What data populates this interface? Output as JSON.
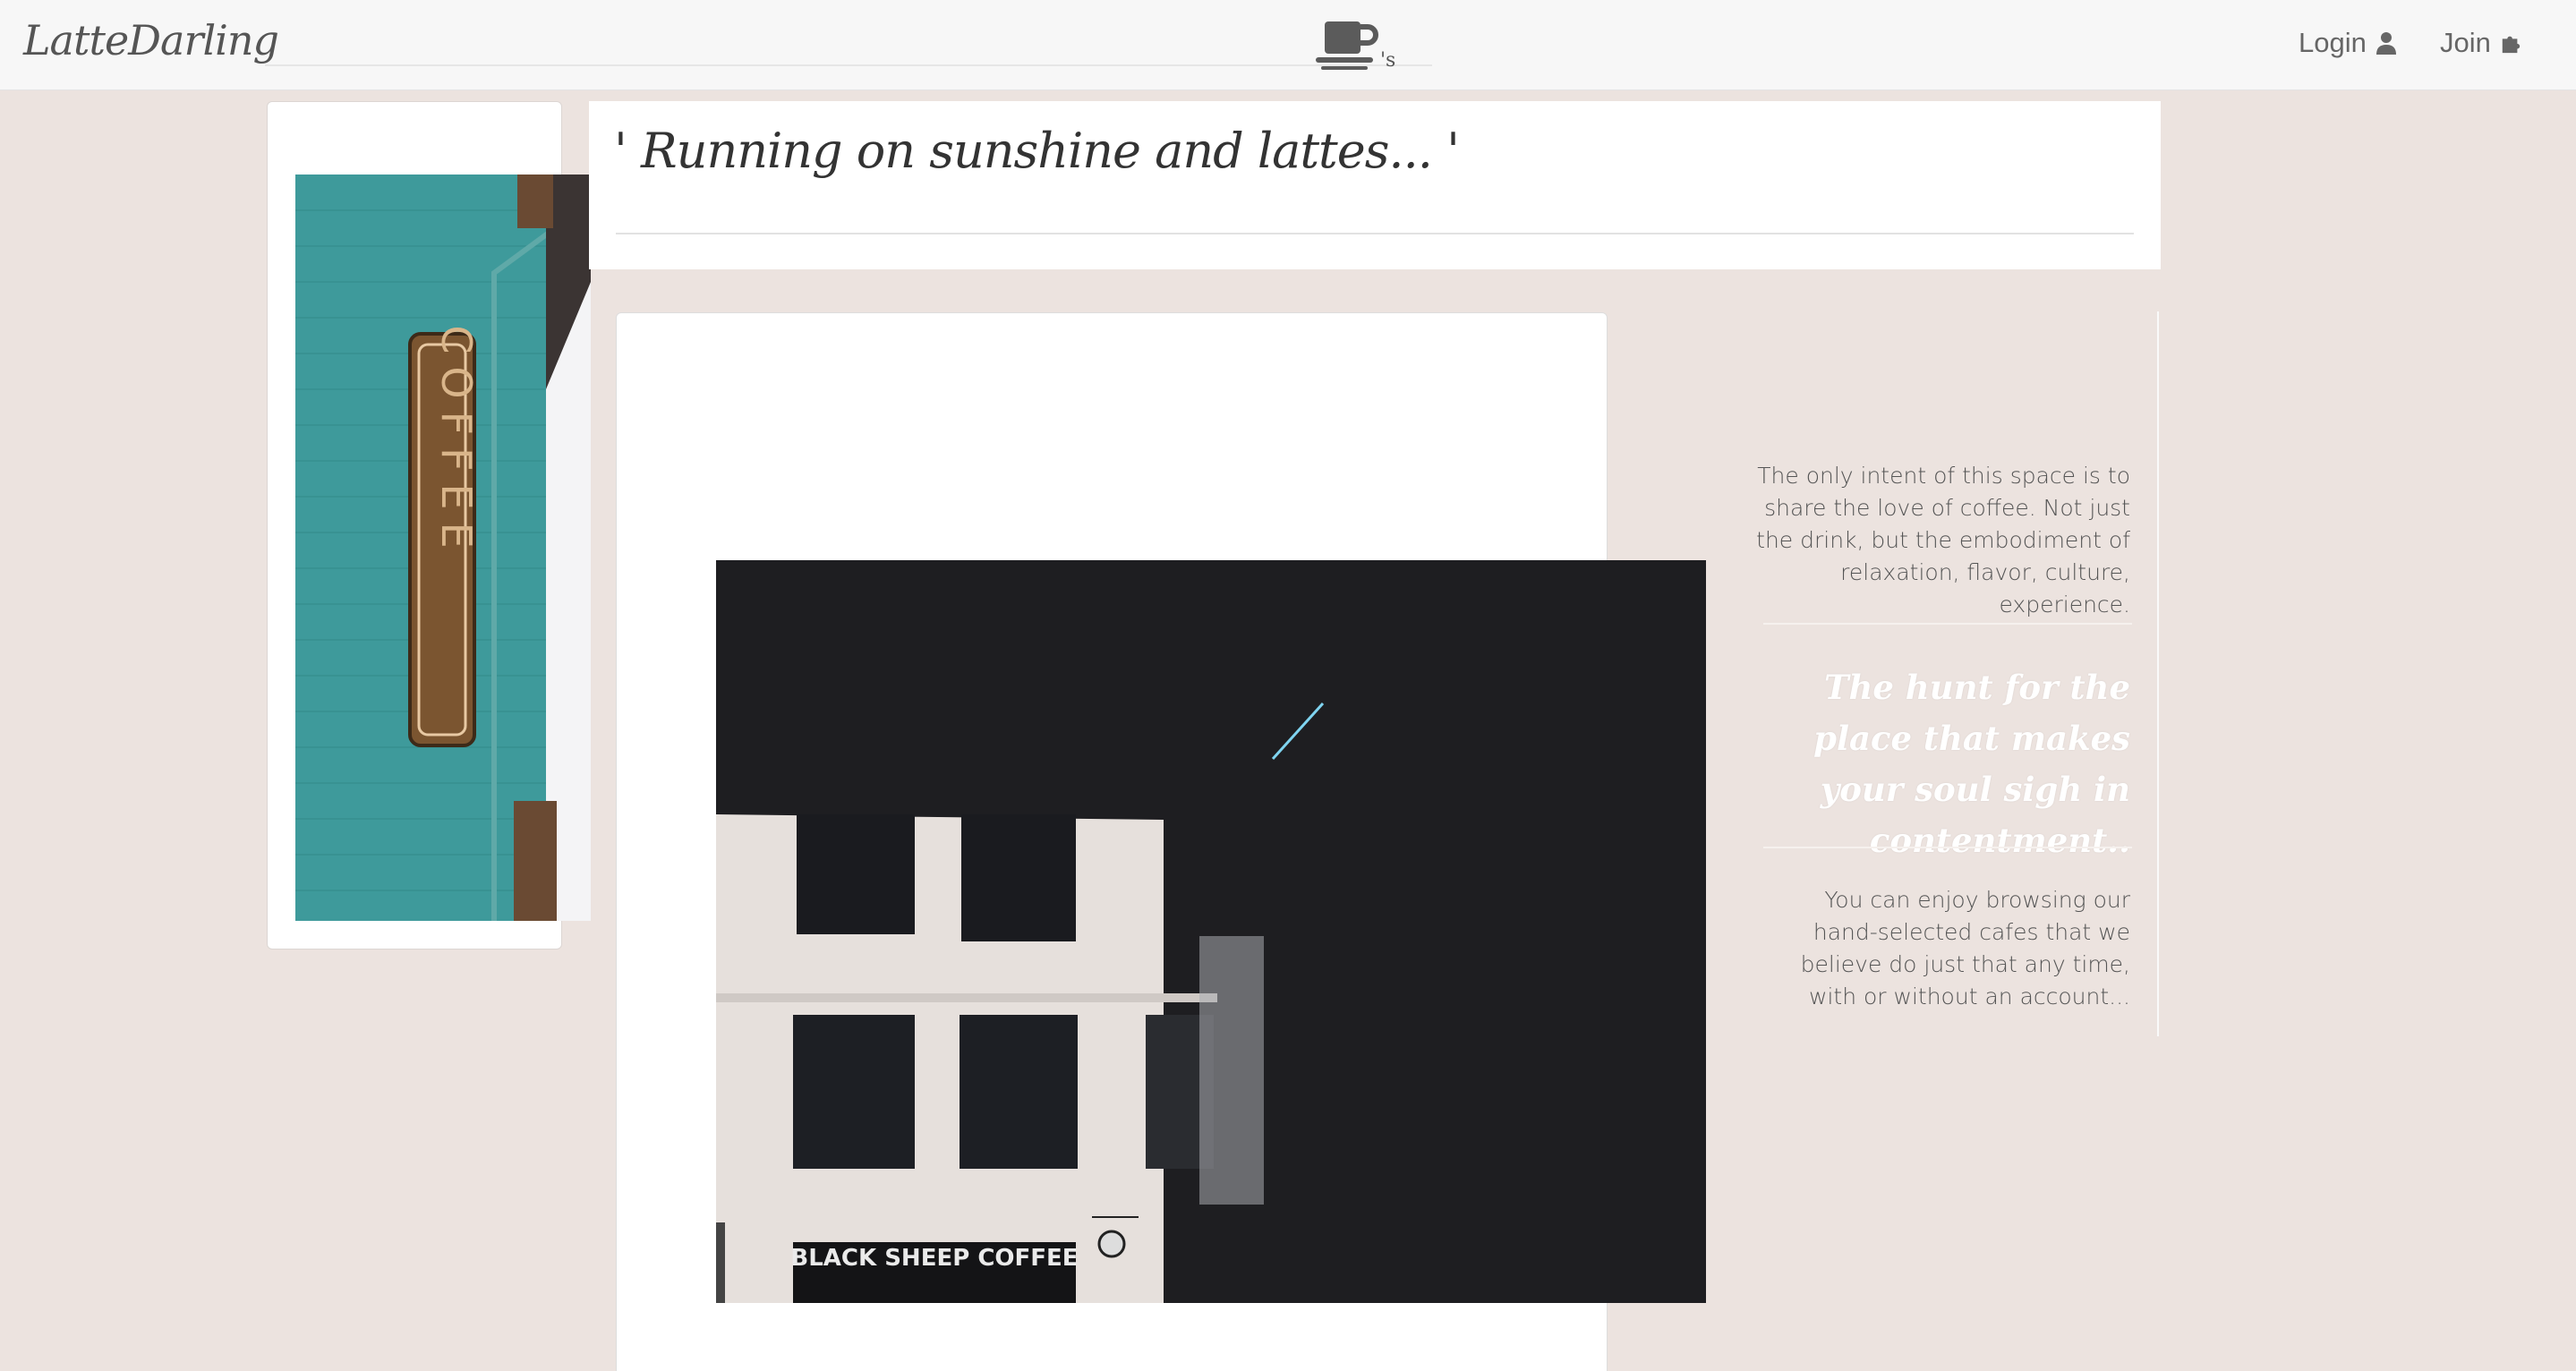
{
  "navbar": {
    "brand": "LatteDarling",
    "logo_suffix": "'s",
    "login_label": "Login",
    "join_label": "Join"
  },
  "header": {
    "quote": "' Running on sunshine and lattes... '"
  },
  "sidebar": {
    "intro": "The only intent of this space is to share the love of coffee. Not just the drink, but the embodiment of relaxation, flavor, culture, experience.",
    "hunt": "The hunt for the place that makes your soul sigh in contentment..",
    "browse": "You can enjoy browsing our hand-selected cafes that we believe do just that any time, with or without an account..."
  },
  "images": {
    "coffee_sign_letters": "COFFEE",
    "storefront_sign": "BLACK SHEEP COFFEE"
  },
  "colors": {
    "page_bg": "#ece3df",
    "navbar_bg": "#f7f7f7",
    "teal_wall": "#3e9a9b",
    "dark_photo": "#1e1e21"
  }
}
